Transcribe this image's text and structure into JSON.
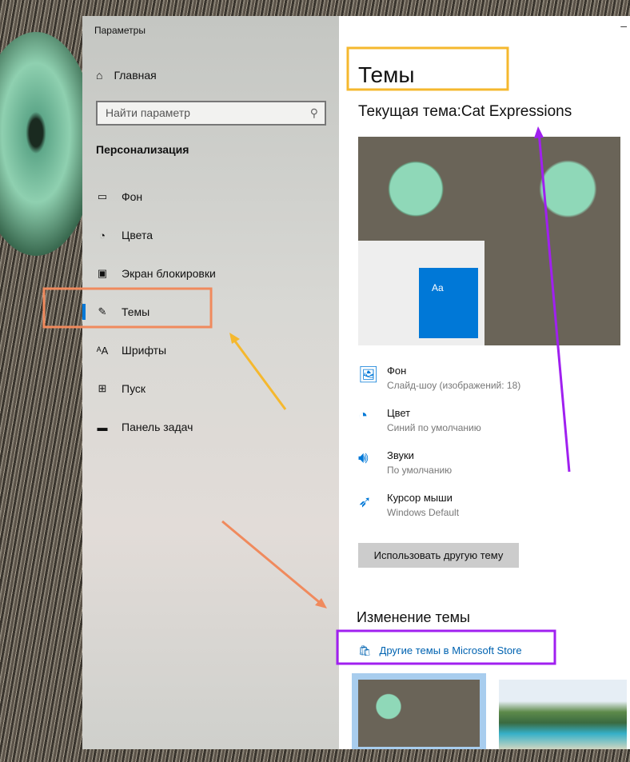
{
  "window": {
    "title": "Параметры",
    "minimize": "–"
  },
  "sidebar": {
    "home": "Главная",
    "search_placeholder": "Найти параметр",
    "section": "Персонализация",
    "items": [
      {
        "label": "Фон",
        "icon": "image-icon"
      },
      {
        "label": "Цвета",
        "icon": "palette-icon"
      },
      {
        "label": "Экран блокировки",
        "icon": "lock-screen-icon"
      },
      {
        "label": "Темы",
        "icon": "brush-icon"
      },
      {
        "label": "Шрифты",
        "icon": "font-icon"
      },
      {
        "label": "Пуск",
        "icon": "start-icon"
      },
      {
        "label": "Панель задач",
        "icon": "taskbar-icon"
      }
    ]
  },
  "main": {
    "title": "Темы",
    "current_theme": "Текущая тема:Cat Expressions",
    "preview_tile": "Aa",
    "props": [
      {
        "title": "Фон",
        "sub": "Слайд-шоу (изображений: 18)"
      },
      {
        "title": "Цвет",
        "sub": "Синий по умолчанию"
      },
      {
        "title": "Звуки",
        "sub": "По умолчанию"
      },
      {
        "title": "Курсор мыши",
        "sub": "Windows Default"
      }
    ],
    "use_other": "Использовать другую тему",
    "change_heading": "Изменение темы",
    "store_link": "Другие темы в Microsoft Store"
  },
  "colors": {
    "accent": "#0078d7",
    "orange": "#f08a5d",
    "yellow": "#f5b82e",
    "purple": "#a020f0"
  }
}
